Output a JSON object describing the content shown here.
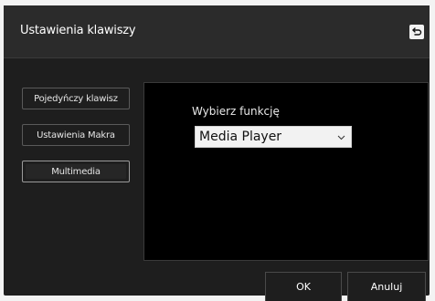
{
  "window": {
    "title": "Ustawienia klawiszy",
    "back_icon": "return-arrow-icon"
  },
  "sidebar": {
    "items": [
      {
        "label": "Pojedyńczy klawisz"
      },
      {
        "label": "Ustawienia Makra"
      },
      {
        "label": "Multimedia"
      }
    ],
    "active_index": 2
  },
  "panel": {
    "label": "Wybierz funkcję",
    "select_value": "Media Player"
  },
  "footer": {
    "ok_label": "OK",
    "cancel_label": "Anuluj"
  },
  "colors": {
    "dialog_bg": "#1e1e1e",
    "panel_bg": "#000000",
    "select_bg": "#f2f2f2"
  }
}
